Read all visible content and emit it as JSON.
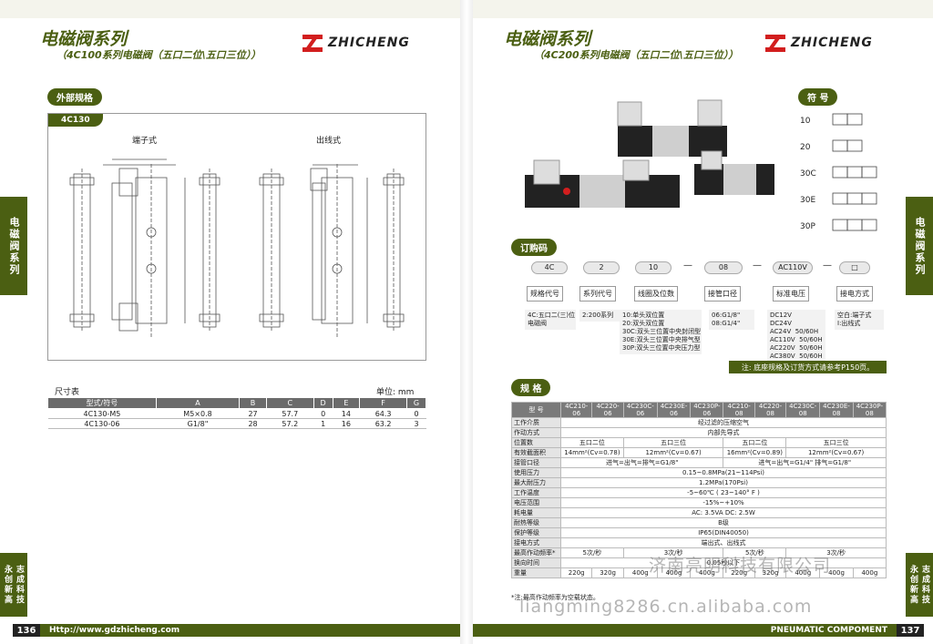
{
  "left": {
    "title": "电磁阀系列",
    "subtitle": "（4C100系列电磁阀（五口二位\\五口三位））",
    "brand": "ZHICHENG",
    "section_label": "外部规格",
    "drawing_tab": "4C130",
    "drawing_labels": [
      "端子式",
      "出线式"
    ],
    "dim_title": "尺寸表",
    "dim_unit": "单位: mm",
    "dim_headers": [
      "型式/符号",
      "A",
      "B",
      "C",
      "D",
      "E",
      "F",
      "G"
    ],
    "dim_rows": [
      [
        "4C130-M5",
        "M5×0.8",
        "27",
        "57.7",
        "0",
        "14",
        "64.3",
        "0"
      ],
      [
        "4C130-06",
        "G1/8\"",
        "28",
        "57.2",
        "1",
        "16",
        "63.2",
        "3"
      ]
    ],
    "side_tab": "电磁阀系列",
    "side_slogan": "志成科技 永创新高",
    "footer": "Http://www.gdzhicheng.com",
    "page_no": "136"
  },
  "right": {
    "title": "电磁阀系列",
    "subtitle": "（4C200系列电磁阀（五口二位\\五口三位））",
    "brand": "ZHICHENG",
    "symbol_label": "符 号",
    "symbols": [
      "10",
      "20",
      "30C",
      "30E",
      "30P"
    ],
    "order_label": "订购码",
    "order_codes": [
      "4C",
      "2",
      "10",
      "08",
      "AC110V",
      "□"
    ],
    "order_dashes": [
      "—",
      "—",
      "—"
    ],
    "order_labels": [
      "规格代号",
      "系列代号",
      "线圈及位数",
      "接管口径",
      "标准电压",
      "接电方式"
    ],
    "order_desc": [
      "4C:五口二(三)位\n电磁阀",
      "2:200系列",
      "10:单头双位置\n20:双头双位置\n30C:双头三位置中央封闭型\n30E:双头三位置中央排气型\n30P:双头三位置中央压力型",
      "06:G1/8\"\n08:G1/4\"",
      "DC12V\nDC24V\nAC24V  50/60H\nAC110V  50/60H\nAC220V  50/60H\nAC380V  50/60H",
      "空白:端子式\nI:出线式"
    ],
    "note": "注: 底座规格及订货方式请参考P150页。",
    "spec_label": "规 格",
    "spec_header": [
      "型 号",
      "4C210-06",
      "4C220-06",
      "4C230C-06",
      "4C230E-06",
      "4C230P-06",
      "4C210-08",
      "4C220-08",
      "4C230C-08",
      "4C230E-08",
      "4C230P-08"
    ],
    "spec_rows": [
      {
        "label": "工作介质",
        "cells": [
          {
            "t": "经过滤的压缩空气",
            "span": 10
          }
        ]
      },
      {
        "label": "作动方式",
        "cells": [
          {
            "t": "内部先导式",
            "span": 10
          }
        ]
      },
      {
        "label": "位置数",
        "cells": [
          {
            "t": "五口二位",
            "span": 2
          },
          {
            "t": "五口三位",
            "span": 3
          },
          {
            "t": "五口二位",
            "span": 2
          },
          {
            "t": "五口三位",
            "span": 3
          }
        ]
      },
      {
        "label": "有效截面积",
        "cells": [
          {
            "t": "14mm²(Cv=0.78)",
            "span": 2
          },
          {
            "t": "12mm²(Cv=0.67)",
            "span": 3
          },
          {
            "t": "16mm²(Cv=0.89)",
            "span": 2
          },
          {
            "t": "12mm²(Cv=0.67)",
            "span": 3
          }
        ]
      },
      {
        "label": "接管口径",
        "cells": [
          {
            "t": "进气=出气=排气=G1/8\"",
            "span": 5
          },
          {
            "t": "进气=出气=G1/4\"  排气=G1/8\"",
            "span": 5
          }
        ]
      },
      {
        "label": "使用压力",
        "cells": [
          {
            "t": "0.15~0.8MPa(21~114Psi)",
            "span": 10
          }
        ]
      },
      {
        "label": "最大耐压力",
        "cells": [
          {
            "t": "1.2MPa(170Psi)",
            "span": 10
          }
        ]
      },
      {
        "label": "工作温度",
        "cells": [
          {
            "t": "-5~60℃ ( 23~140° F )",
            "span": 10
          }
        ]
      },
      {
        "label": "电压范围",
        "cells": [
          {
            "t": "-15%~+10%",
            "span": 10
          }
        ]
      },
      {
        "label": "耗电量",
        "cells": [
          {
            "t": "AC: 3.5VA    DC: 2.5W",
            "span": 10
          }
        ]
      },
      {
        "label": "耐热等级",
        "cells": [
          {
            "t": "B级",
            "span": 10
          }
        ]
      },
      {
        "label": "保护等级",
        "cells": [
          {
            "t": "IP65(DIN40050)",
            "span": 10
          }
        ]
      },
      {
        "label": "接电方式",
        "cells": [
          {
            "t": "端出式、出线式",
            "span": 10
          }
        ]
      },
      {
        "label": "最高作动频率*",
        "cells": [
          {
            "t": "5次/秒",
            "span": 2
          },
          {
            "t": "3次/秒",
            "span": 3
          },
          {
            "t": "5次/秒",
            "span": 2
          },
          {
            "t": "3次/秒",
            "span": 3
          }
        ]
      },
      {
        "label": "换向时间",
        "cells": [
          {
            "t": "0.05秒以下",
            "span": 10
          }
        ]
      },
      {
        "label": "重量",
        "cells": [
          {
            "t": "220g"
          },
          {
            "t": "320g"
          },
          {
            "t": "400g"
          },
          {
            "t": "400g"
          },
          {
            "t": "400g"
          },
          {
            "t": "220g"
          },
          {
            "t": "320g"
          },
          {
            "t": "400g"
          },
          {
            "t": "400g"
          },
          {
            "t": "400g"
          }
        ]
      }
    ],
    "spec_note": "*注:最高作动频率为空载状态。",
    "side_tab": "电磁阀系列",
    "side_slogan": "志成科技 永创新高",
    "footer": "PNEUMATIC COMPOMENT",
    "page_no": "137",
    "watermark1": "济南亮明科技有限公司",
    "watermark2": "liangming8286.cn.alibaba.com"
  }
}
